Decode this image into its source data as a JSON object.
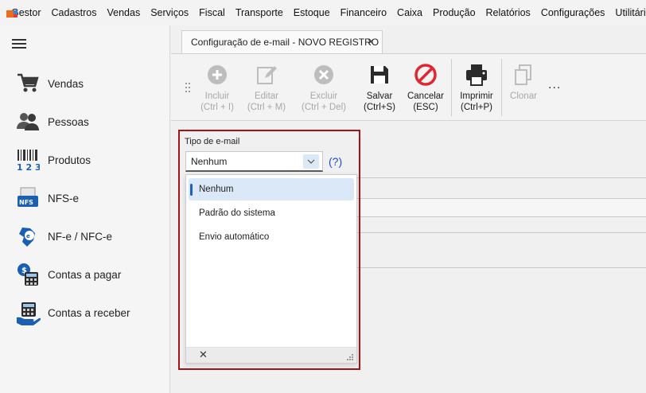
{
  "menu": {
    "app_name": "Gestor",
    "items": [
      "Cadastros",
      "Vendas",
      "Serviços",
      "Fiscal",
      "Transporte",
      "Estoque",
      "Financeiro",
      "Caixa",
      "Produção",
      "Relatórios",
      "Configurações",
      "Utilitários"
    ]
  },
  "sidebar": {
    "items": [
      {
        "label": "Vendas",
        "icon": "shopping-cart-icon"
      },
      {
        "label": "Pessoas",
        "icon": "people-icon"
      },
      {
        "label": "Produtos",
        "icon": "barcode-icon"
      },
      {
        "label": "NFS-e",
        "icon": "nfse-document-icon"
      },
      {
        "label": "NF-e / NFC-e",
        "icon": "nfe-map-icon"
      },
      {
        "label": "Contas a pagar",
        "icon": "bills-to-pay-icon"
      },
      {
        "label": "Contas a receber",
        "icon": "bills-to-receive-icon"
      }
    ]
  },
  "tab": {
    "title": "Configuração de e-mail - NOVO REGISTRO",
    "close": "×"
  },
  "toolbar": {
    "incluir": {
      "line1": "Incluir",
      "line2": "(Ctrl + I)"
    },
    "editar": {
      "line1": "Editar",
      "line2": "(Ctrl + M)"
    },
    "excluir": {
      "line1": "Excluir",
      "line2": "(Ctrl + Del)"
    },
    "salvar": {
      "line1": "Salvar",
      "line2": "(Ctrl+S)"
    },
    "cancelar": {
      "line1": "Cancelar",
      "line2": "(ESC)"
    },
    "imprimir": {
      "line1": "Imprimir",
      "line2": "(Ctrl+P)"
    },
    "clonar": {
      "line1": "Clonar"
    },
    "more": "..."
  },
  "form": {
    "tipo_label": "Tipo de e-mail",
    "tipo_value": "Nenhum",
    "help": "(?)"
  },
  "dropdown": {
    "options": [
      "Nenhum",
      "Padrão do sistema",
      "Envio automático"
    ],
    "selected": "Nenhum",
    "close": "✕"
  },
  "colors": {
    "highlight_border": "#a31515",
    "selected_option_bg": "#dbe8f7",
    "selected_indicator": "#1f5fbf",
    "help_link": "#1a4fc8",
    "cancel_icon": "#e0262e"
  }
}
